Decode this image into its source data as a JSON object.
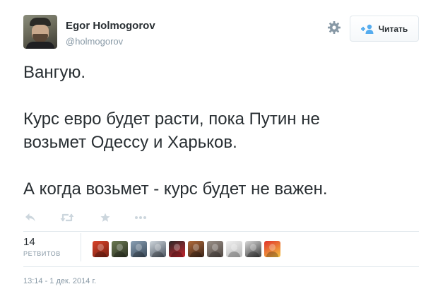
{
  "author": {
    "name": "Egor Holmogorov",
    "handle": "@holmogorov",
    "avatar_icon": "profile-photo"
  },
  "header": {
    "settings_icon": "gear-icon",
    "follow": {
      "label": "Читать",
      "icon": "add-person-icon"
    }
  },
  "tweet": {
    "lines": [
      "Вангую.",
      "",
      "Курс евро будет расти, пока Путин не",
      "возьмет Одессу и Харьков.",
      "",
      "А когда возьмет - курс будет не важен."
    ]
  },
  "actions": {
    "icons": [
      "reply-icon",
      "retweet-icon",
      "favorite-icon",
      "more-icon"
    ]
  },
  "stats": {
    "retweets_count": "14",
    "retweets_label": "РЕТВИТОВ",
    "retweeter_avatars": [
      {
        "name": "retweeter-avatar-1",
        "colors": [
          "#d8442a",
          "#7a1f12"
        ]
      },
      {
        "name": "retweeter-avatar-2",
        "colors": [
          "#6b7a52",
          "#2e3324"
        ]
      },
      {
        "name": "retweeter-avatar-3",
        "colors": [
          "#8aa0b4",
          "#3a4a5a"
        ]
      },
      {
        "name": "retweeter-avatar-4",
        "colors": [
          "#cfd6dc",
          "#4b5561"
        ]
      },
      {
        "name": "retweeter-avatar-5",
        "colors": [
          "#2a2a2a",
          "#c8242c"
        ]
      },
      {
        "name": "retweeter-avatar-6",
        "colors": [
          "#b06a3a",
          "#3c2418"
        ]
      },
      {
        "name": "retweeter-avatar-7",
        "colors": [
          "#9a9088",
          "#514843"
        ]
      },
      {
        "name": "retweeter-avatar-8",
        "colors": [
          "#f0f0f0",
          "#b9b9b9"
        ]
      },
      {
        "name": "retweeter-avatar-9",
        "colors": [
          "#d9d9d9",
          "#3a3a3a"
        ]
      },
      {
        "name": "retweeter-avatar-10",
        "colors": [
          "#e0332b",
          "#f4c542"
        ]
      }
    ]
  },
  "timestamp": "13:14 - 1 дек. 2014 г.",
  "colors": {
    "text": "#292f33",
    "muted": "#8899a6",
    "accent": "#55acee",
    "divider": "#e1e8ed"
  }
}
